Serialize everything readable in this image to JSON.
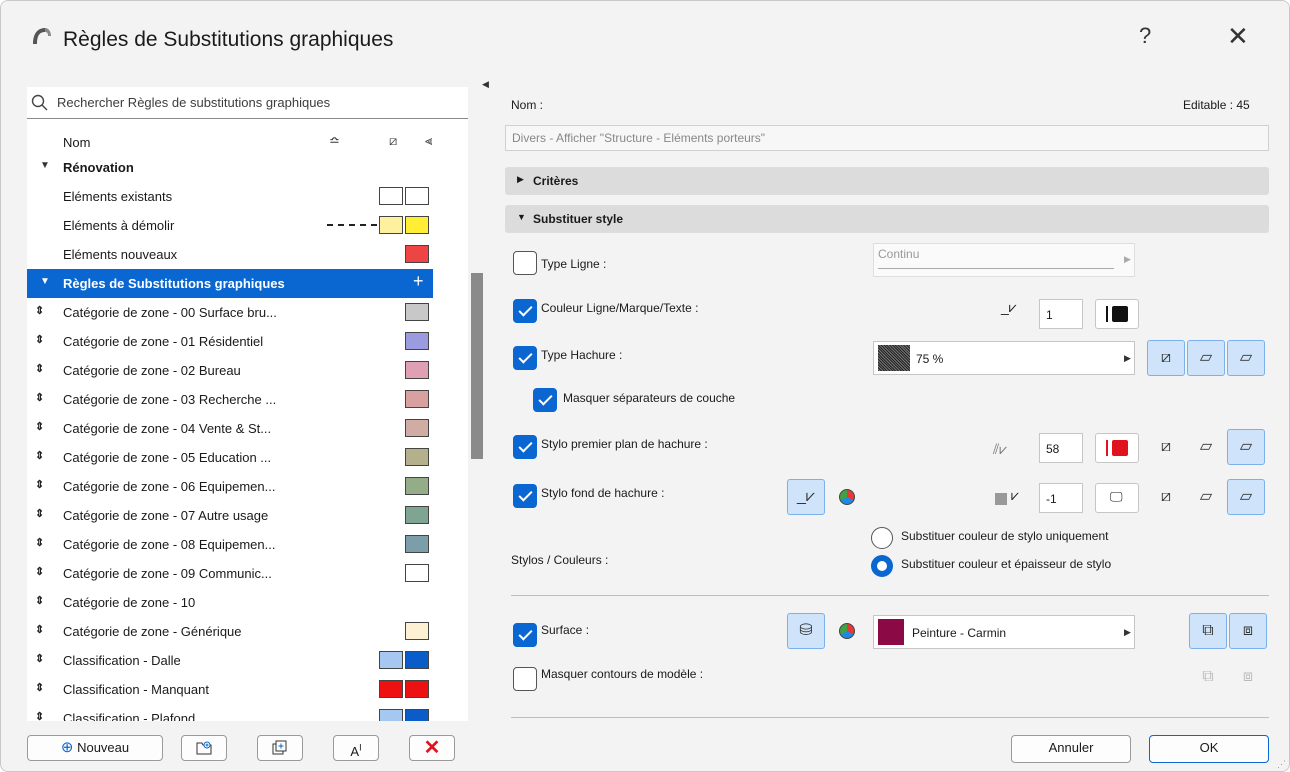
{
  "window": {
    "title": "Règles de Substitutions graphiques",
    "help": "?",
    "close": "✕"
  },
  "search": {
    "placeholder": "Rechercher Règles de substitutions graphiques"
  },
  "list": {
    "header": {
      "nom": "Nom",
      "icon1": "≏",
      "icon2": "⧄",
      "icon3": "⫷"
    },
    "rows": [
      {
        "label": "Rénovation",
        "type": "group"
      },
      {
        "label": "Eléments existants",
        "swatches": [
          "#ffffff",
          "#ffffff"
        ]
      },
      {
        "label": "Eléments à démolir",
        "swatches": [
          "#fdf1a0",
          "#ffee33"
        ],
        "dashed": true
      },
      {
        "label": "Eléments nouveaux",
        "swatches": [
          "#ee4444"
        ]
      },
      {
        "label": "Règles de Substitutions graphiques",
        "type": "group-selected"
      },
      {
        "label": "Catégorie de zone - 00 Surface bru...",
        "swatches": [
          "#c8c8c8"
        ]
      },
      {
        "label": "Catégorie de zone - 01 Résidentiel",
        "swatches": [
          "#9b9be0"
        ]
      },
      {
        "label": "Catégorie de zone - 02 Bureau",
        "swatches": [
          "#e0a0b4"
        ]
      },
      {
        "label": "Catégorie de zone - 03 Recherche ...",
        "swatches": [
          "#d8a0a0"
        ]
      },
      {
        "label": "Catégorie de zone - 04 Vente & St...",
        "swatches": [
          "#d1aca4"
        ]
      },
      {
        "label": "Catégorie de zone - 05 Education ...",
        "swatches": [
          "#b4b08c"
        ]
      },
      {
        "label": "Catégorie de zone - 06 Equipemen...",
        "swatches": [
          "#95ac88"
        ]
      },
      {
        "label": "Catégorie de zone - 07 Autre usage",
        "swatches": [
          "#7fa592"
        ]
      },
      {
        "label": "Catégorie de zone - 08 Equipemen...",
        "swatches": [
          "#7c9ea8"
        ]
      },
      {
        "label": "Catégorie de zone - 09 Communic...",
        "swatches": [
          "#ffffff"
        ]
      },
      {
        "label": "Catégorie de zone - 10",
        "swatches": []
      },
      {
        "label": "Catégorie de zone - Générique",
        "swatches": [
          "#fdf1d4"
        ]
      },
      {
        "label": "Classification - Dalle",
        "swatches": [
          "#a6c8f0",
          "#0a5cc8"
        ]
      },
      {
        "label": "Classification - Manquant",
        "swatches": [
          "#ee1111",
          "#ee1111"
        ]
      },
      {
        "label": "Classification - Plafond",
        "swatches": [
          "#a6c8f0",
          "#0a5cc8"
        ]
      }
    ]
  },
  "bottom": {
    "nouveau": "Nouveau",
    "nouveau_icon": "⊕"
  },
  "details": {
    "nom_label": "Nom :",
    "editable": "Editable : 45",
    "nom_value": "Divers - Afficher \"Structure - Eléments porteurs\"",
    "criteres": "Critères",
    "substituer": "Substituer style",
    "type_ligne": "Type Ligne :",
    "type_ligne_value": "Continu",
    "couleur_ligne": "Couleur Ligne/Marque/Texte :",
    "couleur_ligne_num": "1",
    "type_hachure": "Type Hachure :",
    "hachure_value": "75 %",
    "masquer_sep": "Masquer séparateurs de couche",
    "stylo_premier": "Stylo premier plan de hachure :",
    "stylo_premier_num": "58",
    "stylo_fond": "Stylo fond de hachure :",
    "stylo_fond_num": "-1",
    "stylos_couleurs": "Stylos / Couleurs :",
    "radio1": "Substituer couleur de stylo uniquement",
    "radio2": "Substituer couleur et épaisseur de stylo",
    "surface": "Surface :",
    "surface_value": "Peinture - Carmin",
    "masquer_contours": "Masquer contours de modèle :",
    "annuler": "Annuler",
    "ok": "OK"
  },
  "colors": {
    "accent": "#0a66d0",
    "carmin": "#8b0a45",
    "red": "#e0141e"
  }
}
